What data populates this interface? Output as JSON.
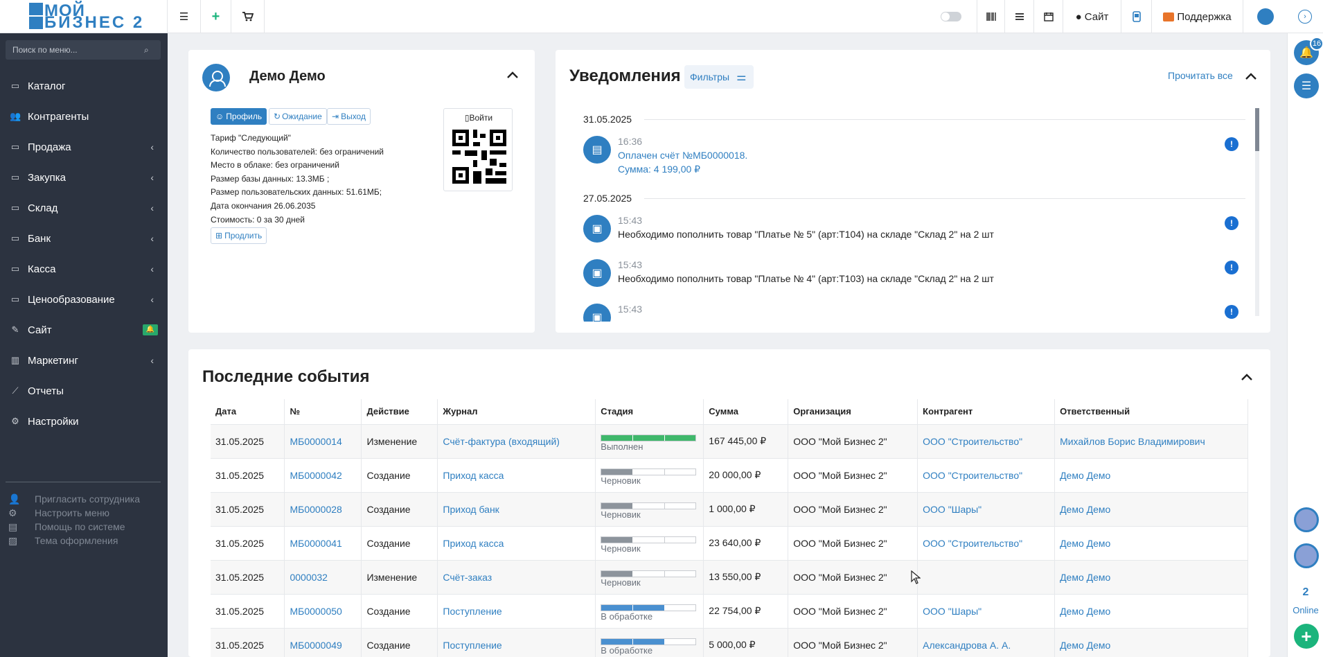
{
  "app": {
    "logo_line1": "МОЙ",
    "logo_line2": "БИЗНЕС 2",
    "accent": "#2f7fc1"
  },
  "topbar": {
    "menu_icon": "hamburger-icon",
    "add_icon": "plus-icon",
    "cart_icon": "cart-icon",
    "site_label": "Сайт",
    "support_label": "Поддержка"
  },
  "sidebar": {
    "search_placeholder": "Поиск по меню...",
    "items": [
      {
        "label": "Каталог",
        "icon": "folder-icon",
        "chev": ""
      },
      {
        "label": "Контрагенты",
        "icon": "users-icon",
        "chev": ""
      },
      {
        "label": "Продажа",
        "icon": "folder-icon",
        "chev": "‹"
      },
      {
        "label": "Закупка",
        "icon": "folder-icon",
        "chev": "‹"
      },
      {
        "label": "Склад",
        "icon": "folder-icon",
        "chev": "‹"
      },
      {
        "label": "Банк",
        "icon": "folder-icon",
        "chev": "‹"
      },
      {
        "label": "Касса",
        "icon": "folder-icon",
        "chev": "‹"
      },
      {
        "label": "Ценообразование",
        "icon": "folder-icon",
        "chev": "‹"
      },
      {
        "label": "Сайт",
        "icon": "magic-icon",
        "chev": ""
      },
      {
        "label": "Маркетинг",
        "icon": "chart-bar-icon",
        "chev": "‹"
      },
      {
        "label": "Отчеты",
        "icon": "line-chart-icon",
        "chev": ""
      },
      {
        "label": "Настройки",
        "icon": "gear-icon",
        "chev": ""
      }
    ],
    "extras": [
      {
        "label": "Пригласить сотрудника",
        "icon": "user-plus-icon"
      },
      {
        "label": "Настроить меню",
        "icon": "gears-icon"
      },
      {
        "label": "Помощь по системе",
        "icon": "book-icon"
      },
      {
        "label": "Тема оформления",
        "icon": "image-icon"
      }
    ]
  },
  "profile": {
    "name": "Демо Демо",
    "buttons": {
      "profile": "Профиль",
      "waiting": "Ожидание",
      "logout": "Выход"
    },
    "info": [
      "Тариф \"Следующий\"",
      "Количество пользователей: без ограничений",
      "Место в облаке: без ограничений",
      "Размер базы данных: 13.3МБ ;",
      "Размер пользовательских данных: 51.61МБ;",
      "Дата окончания 26.06.2035",
      "Стоимость: 0 за 30 дней"
    ],
    "extend": "Продлить",
    "qr_login": "Войти"
  },
  "notifications": {
    "title": "Уведомления",
    "filters": "Фильтры",
    "read_all": "Прочитать все",
    "groups": [
      {
        "date": "31.05.2025",
        "items": [
          {
            "time": "16:36",
            "line1": "Оплачен счёт №МБ0000018.",
            "line2": "Сумма: 4 199,00 ₽",
            "icon": "document-icon"
          }
        ]
      },
      {
        "date": "27.05.2025",
        "items": [
          {
            "time": "15:43",
            "line1": "Необходимо пополнить товар \"Платье № 5\" (арт:Т104) на складе \"Склад 2\" на 2 шт",
            "icon": "box-icon"
          },
          {
            "time": "15:43",
            "line1": "Необходимо пополнить товар \"Платье № 4\" (арт:Т103) на складе \"Склад 2\" на 2 шт",
            "icon": "box-icon"
          },
          {
            "time": "15:43",
            "line1": "",
            "icon": "box-icon"
          }
        ]
      }
    ]
  },
  "rail": {
    "notif_count": "16",
    "online_count": "2",
    "online_label": "Online"
  },
  "events": {
    "title": "Последние события",
    "columns": [
      "Дата",
      "№",
      "Действие",
      "Журнал",
      "Стадия",
      "Сумма",
      "Организация",
      "Контрагент",
      "Ответственный"
    ],
    "rows": [
      {
        "date": "31.05.2025",
        "num": "МБ0000014",
        "action": "Изменение",
        "journal": "Счёт-фактура (входящий)",
        "stage": "Выполнен",
        "stage_level": 3,
        "stage_color": "#3fb86b",
        "sum": "167 445,00 ₽",
        "org": "ООО \"Мой Бизнес 2\"",
        "party": "ООО \"Строительство\"",
        "resp": "Михайлов Борис Владимирович"
      },
      {
        "date": "31.05.2025",
        "num": "МБ0000042",
        "action": "Создание",
        "journal": "Приход касса",
        "stage": "Черновик",
        "stage_level": 1,
        "stage_color": "#8d949c",
        "sum": "20 000,00 ₽",
        "org": "ООО \"Мой Бизнес 2\"",
        "party": "ООО \"Строительство\"",
        "resp": "Демо Демо"
      },
      {
        "date": "31.05.2025",
        "num": "МБ0000028",
        "action": "Создание",
        "journal": "Приход банк",
        "stage": "Черновик",
        "stage_level": 1,
        "stage_color": "#8d949c",
        "sum": "1 000,00 ₽",
        "org": "ООО \"Мой Бизнес 2\"",
        "party": "ООО \"Шары\"",
        "resp": "Демо Демо"
      },
      {
        "date": "31.05.2025",
        "num": "МБ0000041",
        "action": "Создание",
        "journal": "Приход касса",
        "stage": "Черновик",
        "stage_level": 1,
        "stage_color": "#8d949c",
        "sum": "23 640,00 ₽",
        "org": "ООО \"Мой Бизнес 2\"",
        "party": "ООО \"Строительство\"",
        "resp": "Демо Демо"
      },
      {
        "date": "31.05.2025",
        "num": "0000032",
        "action": "Изменение",
        "journal": "Счёт-заказ",
        "stage": "Черновик",
        "stage_level": 1,
        "stage_color": "#8d949c",
        "sum": "13 550,00 ₽",
        "org": "ООО \"Мой Бизнес 2\"",
        "party": "",
        "resp": "Демо Демо"
      },
      {
        "date": "31.05.2025",
        "num": "МБ0000050",
        "action": "Создание",
        "journal": "Поступление",
        "stage": "В обработке",
        "stage_level": 2,
        "stage_color": "#4a90d0",
        "sum": "22 754,00 ₽",
        "org": "ООО \"Мой Бизнес 2\"",
        "party": "ООО \"Шары\"",
        "resp": "Демо Демо"
      },
      {
        "date": "31.05.2025",
        "num": "МБ0000049",
        "action": "Создание",
        "journal": "Поступление",
        "stage": "В обработке",
        "stage_level": 2,
        "stage_color": "#4a90d0",
        "sum": "5 000,00 ₽",
        "org": "ООО \"Мой Бизнес 2\"",
        "party": "Александрова А. А.",
        "resp": "Демо Демо"
      }
    ]
  }
}
